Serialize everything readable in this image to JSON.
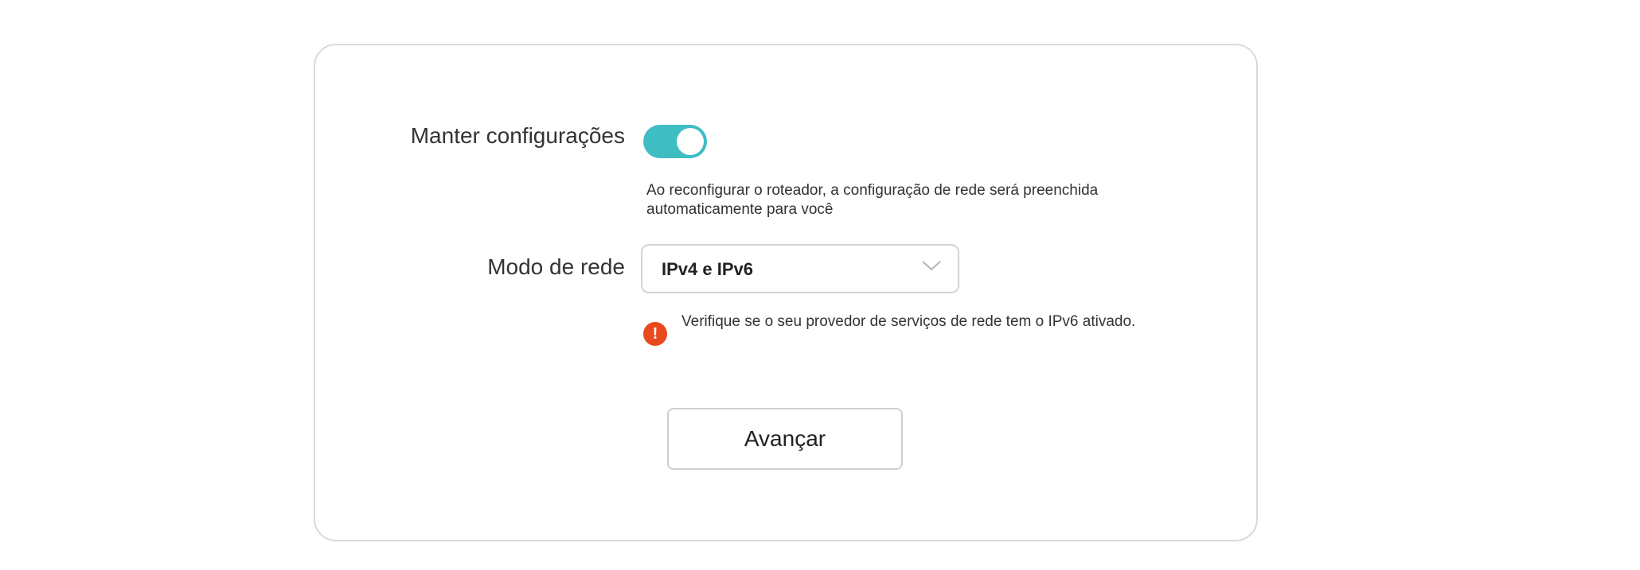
{
  "form": {
    "keep_settings_label": "Manter configurações",
    "keep_settings_enabled": true,
    "keep_settings_hint": "Ao reconfigurar o roteador, a configuração de rede será preenchida automaticamente para você",
    "network_mode_label": "Modo de rede",
    "network_mode_value": "IPv4 e IPv6",
    "warning_text": "Verifique se o seu provedor de serviços de rede tem o IPv6 ativado.",
    "warning_icon": "!",
    "next_button_label": "Avançar"
  },
  "colors": {
    "toggle_on": "#3ebdc3",
    "warning": "#e8491d"
  },
  "icons": {
    "toggle": "toggle-switch",
    "dropdown": "chevron-down-icon",
    "warning": "exclamation-circle-icon"
  }
}
